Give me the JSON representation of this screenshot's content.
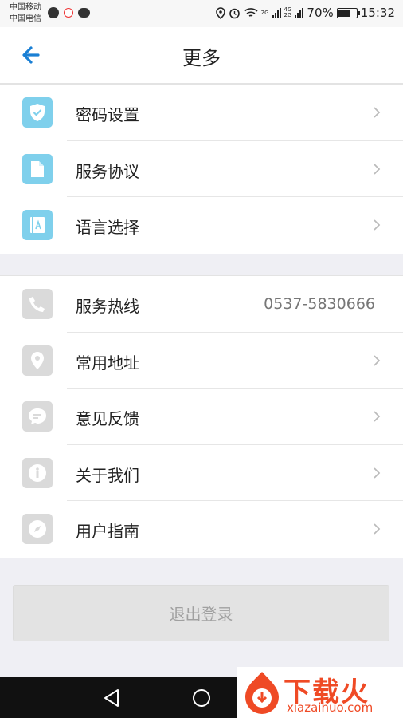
{
  "status_bar": {
    "carrier1": "中国移动",
    "carrier2": "中国电信",
    "net1": "2G",
    "net2": "4G",
    "net3": "2G",
    "battery_pct": "70%",
    "battery_level": 0.7,
    "time": "15:32"
  },
  "header": {
    "title": "更多",
    "back_icon": "arrow-left-icon"
  },
  "group1": [
    {
      "label": "密码设置",
      "icon": "shield-check-icon"
    },
    {
      "label": "服务协议",
      "icon": "document-icon"
    },
    {
      "label": "语言选择",
      "icon": "language-book-icon"
    }
  ],
  "group2": [
    {
      "label": "服务热线",
      "icon": "phone-icon",
      "value": "0537-5830666"
    },
    {
      "label": "常用地址",
      "icon": "location-pin-icon"
    },
    {
      "label": "意见反馈",
      "icon": "chat-bubble-icon"
    },
    {
      "label": "关于我们",
      "icon": "info-icon"
    },
    {
      "label": "用户指南",
      "icon": "compass-icon"
    }
  ],
  "logout_label": "退出登录",
  "watermark": {
    "brand": "下载火",
    "url": "xiazaihuo.com"
  },
  "colors": {
    "accent_blue": "#1a7fd4",
    "icon_blue": "#7fd0ec",
    "icon_gray": "#dadada",
    "watermark": "#ef4a25"
  }
}
